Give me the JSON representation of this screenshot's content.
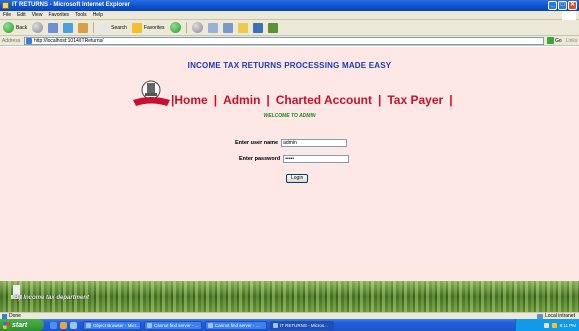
{
  "window": {
    "title": "IT RETURNS - Microsoft Internet Explorer",
    "minimize": "_",
    "maximize": "□",
    "close": "✕"
  },
  "menu": [
    "File",
    "Edit",
    "View",
    "Favorites",
    "Tools",
    "Help"
  ],
  "toolbar": {
    "back": "Back",
    "search": "Search",
    "favorites": "Favorites"
  },
  "address": {
    "label": "Address",
    "url": "http://localhost:1014/ITReturns/",
    "go": "Go",
    "links": "Links"
  },
  "page": {
    "heading": "INCOME TAX RETURNS PROCESSING MADE EASY",
    "nav": {
      "separator": "|",
      "items": [
        "Home",
        "Admin",
        "Charted Account",
        "Tax Payer"
      ]
    },
    "welcome": "WELCOME TO ADMIN",
    "form": {
      "username_label": "Enter user name",
      "username_value": "admin",
      "password_label": "Enter password",
      "password_value": "•••••",
      "login_label": "Login"
    },
    "footer_text": "By Income tax department"
  },
  "status": {
    "left": "Done",
    "zone": "Local intranet"
  },
  "taskbar": {
    "start": "start",
    "buttons": [
      {
        "label": "Object Browser - Micr...",
        "active": false
      },
      {
        "label": "Cannot find server - ...",
        "active": false
      },
      {
        "label": "Cannot find server - ...",
        "active": false
      },
      {
        "label": "IT RETURNS - Micros...",
        "active": true
      }
    ],
    "time": "8:11 PM"
  },
  "colors": {
    "heading": "#1a3ac2",
    "nav": "#c8102e",
    "welcome": "#1e8a1e",
    "page_bg": "#fde8e6"
  }
}
